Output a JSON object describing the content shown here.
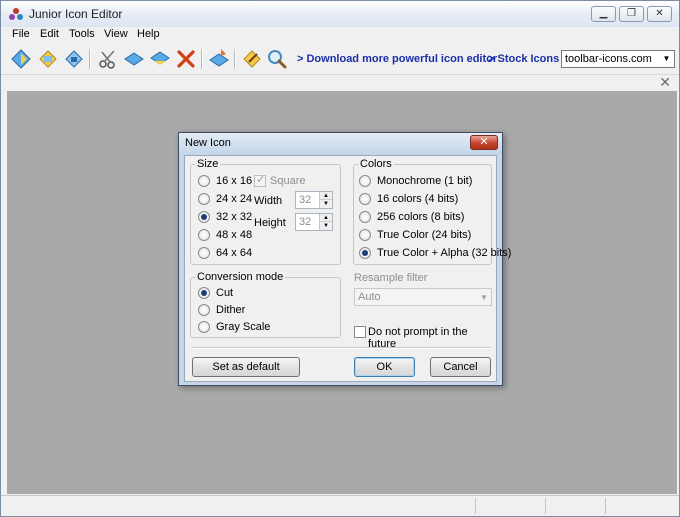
{
  "window": {
    "title": "Junior Icon Editor"
  },
  "menu": [
    "File",
    "Edit",
    "Tools",
    "View",
    "Help"
  ],
  "toolbar": {
    "icons": [
      "new-icon",
      "open-icon",
      "save-icon",
      "cut-icon",
      "copy-icon",
      "paste-icon",
      "delete-icon",
      "import-icon",
      "edit-icon",
      "zoom-icon"
    ],
    "links": [
      "> Download more powerful icon editor",
      "> Stock Icons"
    ],
    "site_combo": "toolbar-icons.com"
  },
  "dialog": {
    "title": "New Icon",
    "close_glyph": "✕",
    "size": {
      "label": "Size",
      "options": [
        {
          "label": "16 x 16",
          "checked": false
        },
        {
          "label": "24 x 24",
          "checked": false
        },
        {
          "label": "32 x 32",
          "checked": true
        },
        {
          "label": "48 x 48",
          "checked": false
        },
        {
          "label": "64 x 64",
          "checked": false
        }
      ],
      "square_label": "Square",
      "square_checked": true,
      "width_label": "Width",
      "width_value": "32",
      "height_label": "Height",
      "height_value": "32"
    },
    "colors": {
      "label": "Colors",
      "options": [
        {
          "label": "Monochrome (1 bit)",
          "checked": false
        },
        {
          "label": "16 colors (4 bits)",
          "checked": false
        },
        {
          "label": "256 colors (8 bits)",
          "checked": false
        },
        {
          "label": "True Color (24 bits)",
          "checked": false
        },
        {
          "label": "True Color + Alpha (32 bits)",
          "checked": true
        }
      ]
    },
    "conversion": {
      "label": "Conversion mode",
      "options": [
        {
          "label": "Cut",
          "checked": true
        },
        {
          "label": "Dither",
          "checked": false
        },
        {
          "label": "Gray Scale",
          "checked": false
        }
      ]
    },
    "resample": {
      "label": "Resample filter",
      "value": "Auto"
    },
    "no_prompt_label": "Do not prompt in the future",
    "no_prompt_checked": false,
    "buttons": {
      "set_default": "Set as default",
      "ok": "OK",
      "cancel": "Cancel"
    }
  },
  "colors": {
    "workspace": "#a9a9a9",
    "link": "#1c2fa8",
    "dialog_frame": "#c8d6e8",
    "close_red": "#c5452d"
  }
}
